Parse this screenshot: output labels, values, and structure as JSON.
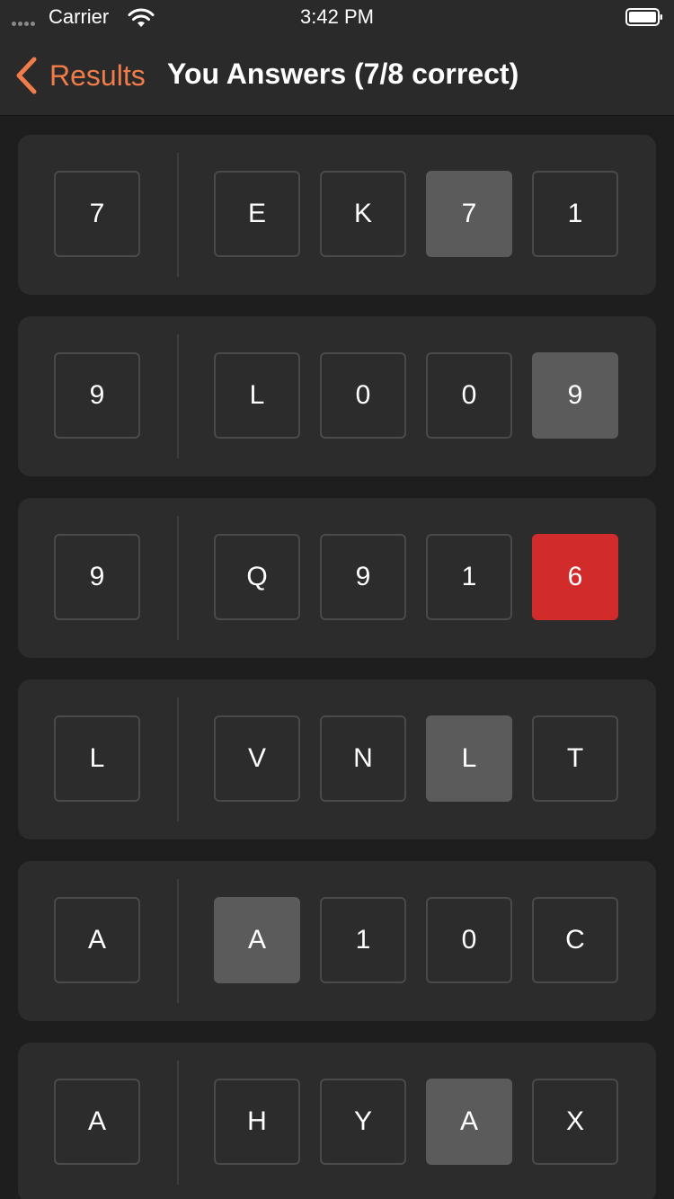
{
  "status_bar": {
    "carrier": "Carrier",
    "time": "3:42 PM",
    "icons": [
      "signal-dots-icon",
      "wifi-icon",
      "battery-icon"
    ]
  },
  "nav": {
    "back_label": "Results",
    "title": "You Answers (7/8 correct)",
    "accent_color": "#f07c49"
  },
  "colors": {
    "highlight": "#5b5b5b",
    "wrong": "#d12b2b",
    "card": "#2c2c2c",
    "background": "#1e1e1e"
  },
  "rows": [
    {
      "target": "7",
      "options": [
        {
          "label": "E",
          "state": "normal"
        },
        {
          "label": "K",
          "state": "normal"
        },
        {
          "label": "7",
          "state": "highlight"
        },
        {
          "label": "1",
          "state": "normal"
        }
      ]
    },
    {
      "target": "9",
      "options": [
        {
          "label": "L",
          "state": "normal"
        },
        {
          "label": "0",
          "state": "normal"
        },
        {
          "label": "0",
          "state": "normal"
        },
        {
          "label": "9",
          "state": "highlight"
        }
      ]
    },
    {
      "target": "9",
      "options": [
        {
          "label": "Q",
          "state": "normal"
        },
        {
          "label": "9",
          "state": "normal"
        },
        {
          "label": "1",
          "state": "normal"
        },
        {
          "label": "6",
          "state": "wrong"
        }
      ]
    },
    {
      "target": "L",
      "options": [
        {
          "label": "V",
          "state": "normal"
        },
        {
          "label": "N",
          "state": "normal"
        },
        {
          "label": "L",
          "state": "highlight"
        },
        {
          "label": "T",
          "state": "normal"
        }
      ]
    },
    {
      "target": "A",
      "options": [
        {
          "label": "A",
          "state": "highlight"
        },
        {
          "label": "1",
          "state": "normal"
        },
        {
          "label": "0",
          "state": "normal"
        },
        {
          "label": "C",
          "state": "normal"
        }
      ]
    },
    {
      "target": "A",
      "options": [
        {
          "label": "H",
          "state": "normal"
        },
        {
          "label": "Y",
          "state": "normal"
        },
        {
          "label": "A",
          "state": "highlight"
        },
        {
          "label": "X",
          "state": "normal"
        }
      ]
    }
  ]
}
